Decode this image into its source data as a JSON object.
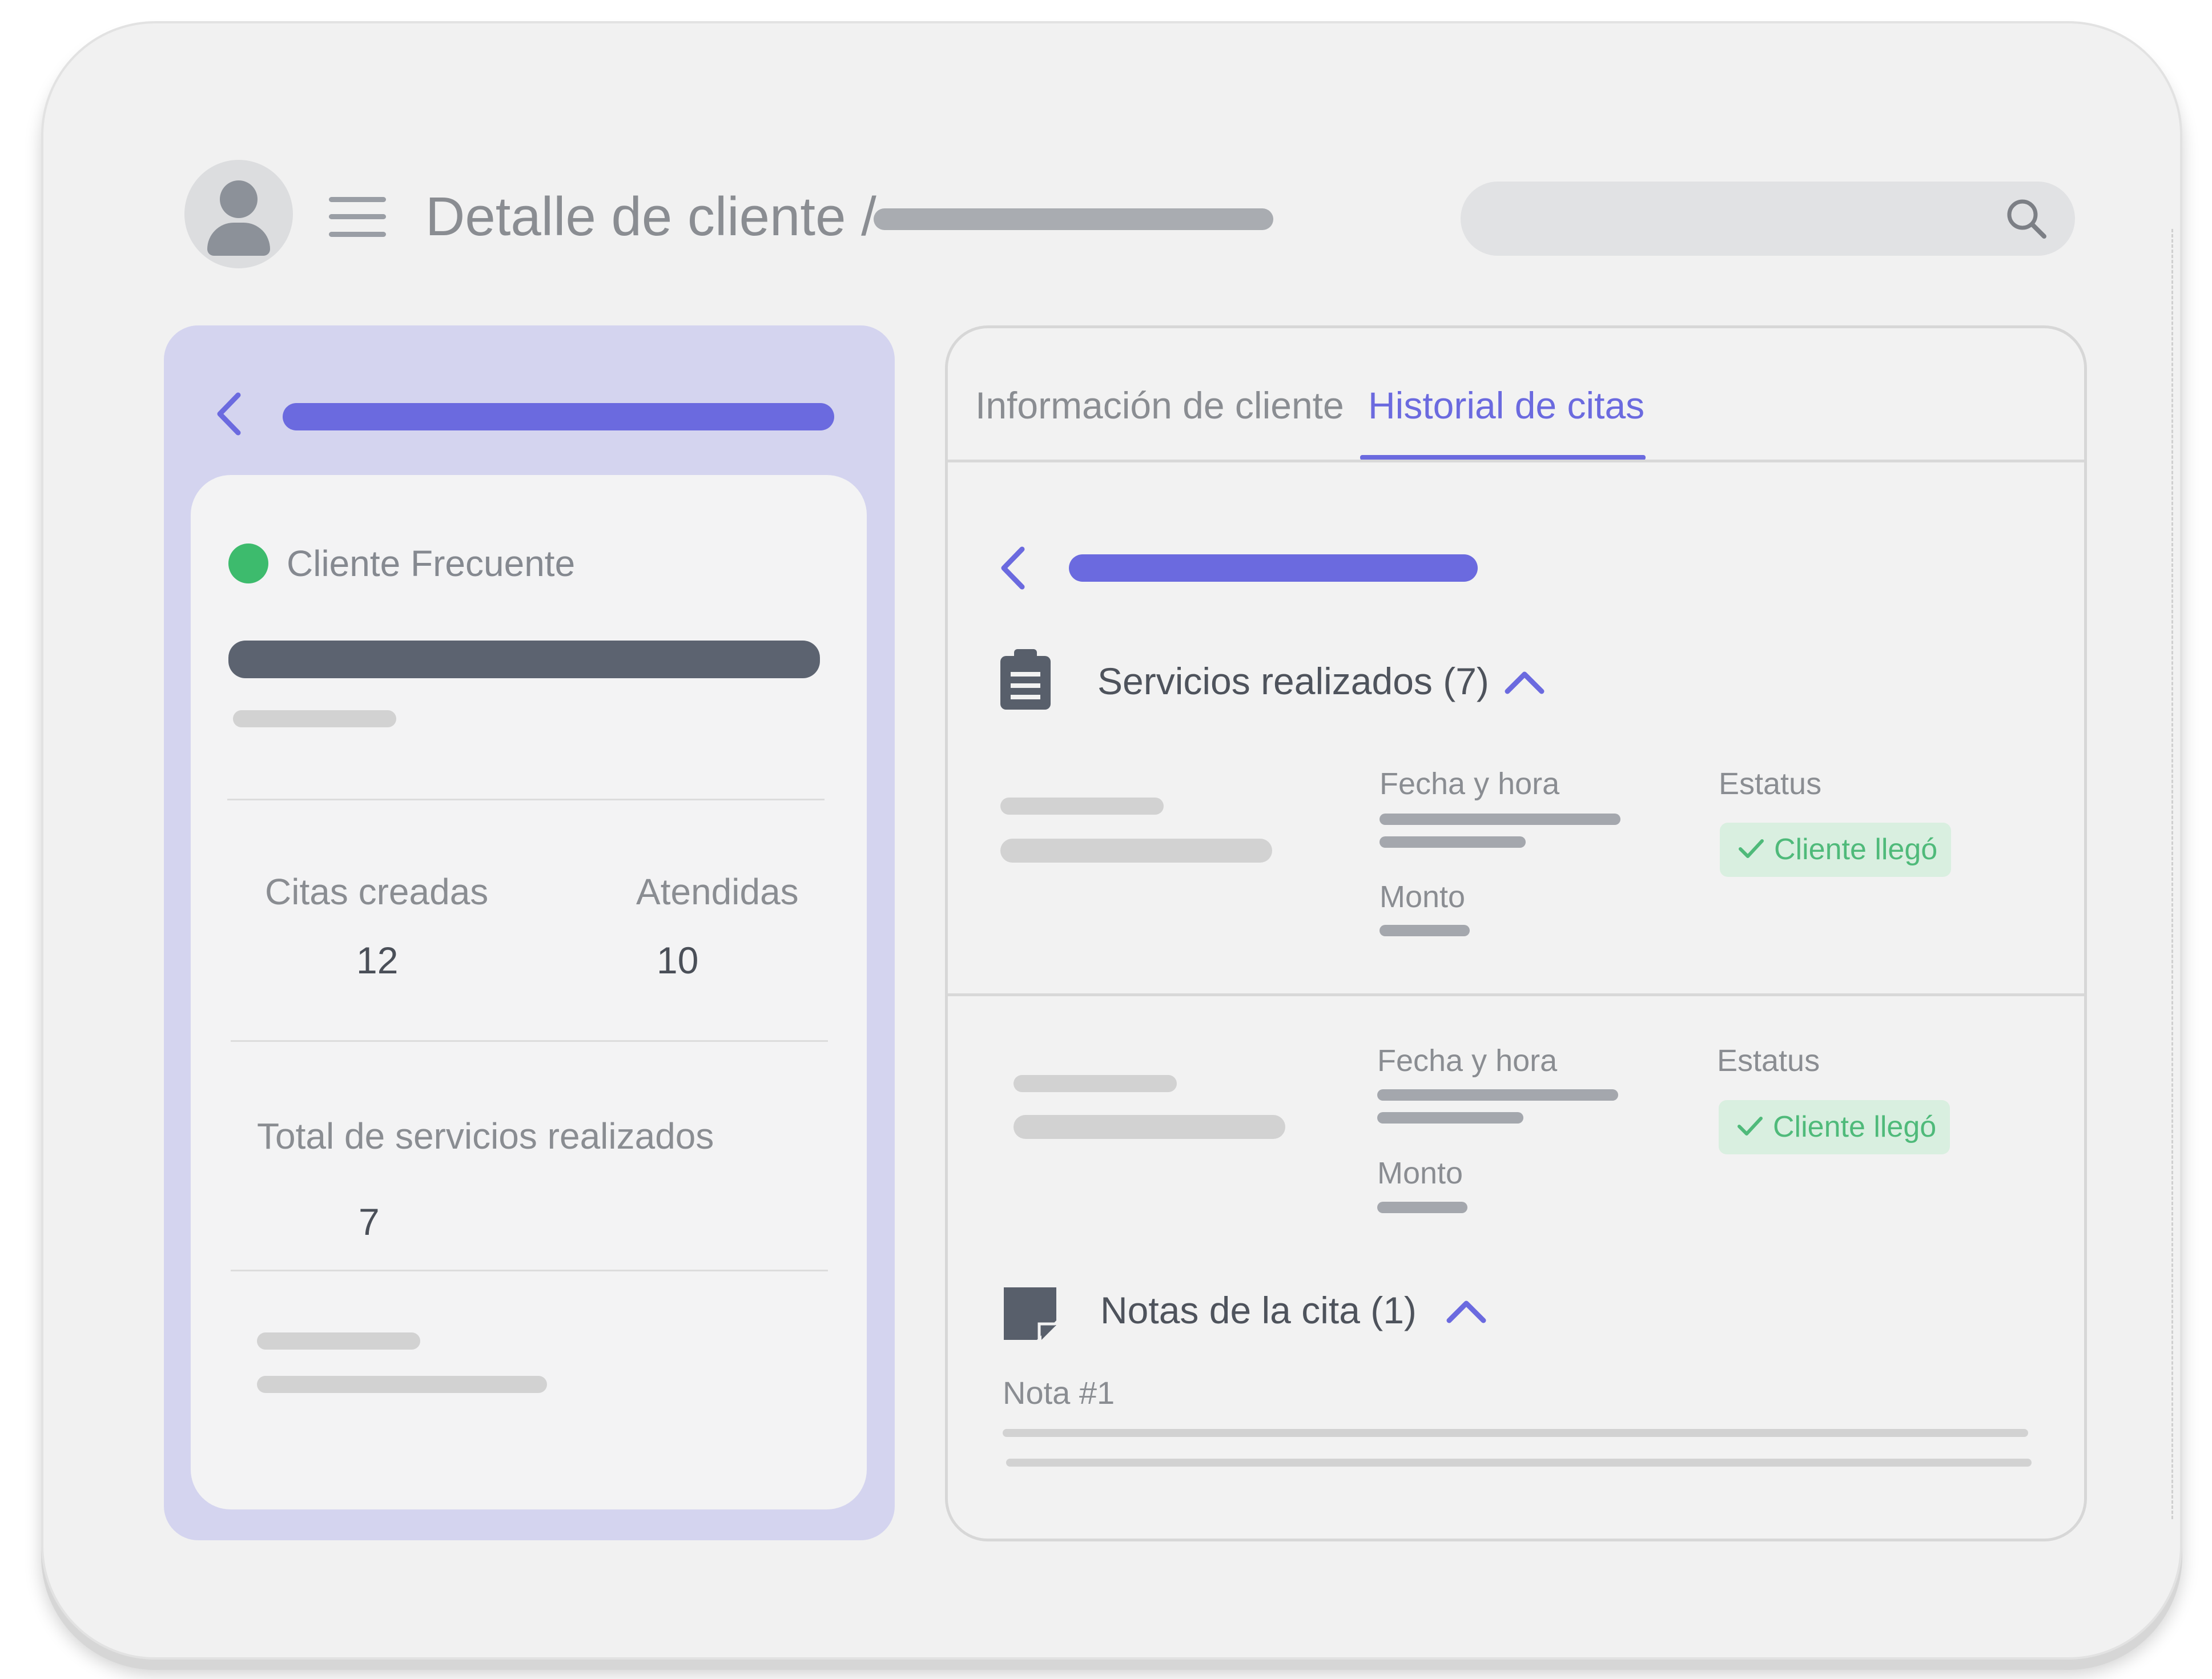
{
  "header": {
    "title": "Detalle de cliente /"
  },
  "left_panel": {
    "status_label": "Cliente Frecuente",
    "stats": [
      {
        "label": "Citas creadas",
        "value": "12"
      },
      {
        "label": "Atendidas",
        "value": "10"
      }
    ],
    "total": {
      "label": "Total de servicios realizados",
      "value": "7"
    }
  },
  "tabs": [
    {
      "label": "Información de cliente",
      "active": false
    },
    {
      "label": "Historial de citas",
      "active": true
    }
  ],
  "services": {
    "title": "Servicios realizados (7)",
    "rows": [
      {
        "date_label": "Fecha y hora",
        "amount_label": "Monto",
        "status_label": "Estatus",
        "status": "Cliente llegó"
      },
      {
        "date_label": "Fecha y hora",
        "amount_label": "Monto",
        "status_label": "Estatus",
        "status": "Cliente llegó"
      }
    ]
  },
  "notes": {
    "title": "Notas de la cita (1)",
    "items": [
      {
        "label": "Nota #1"
      }
    ]
  },
  "colors": {
    "accent": "#6b6adf",
    "panel": "#d4d4ef",
    "success": "#3dbb6d",
    "success_bg": "#d9efe0"
  },
  "icons": {
    "avatar": "user-icon",
    "menu": "hamburger-menu-icon",
    "search": "search-icon",
    "back": "chevron-left-icon",
    "services": "clipboard-icon",
    "notes": "sticky-note-icon",
    "collapse": "chevron-up-icon",
    "check": "check-icon"
  }
}
